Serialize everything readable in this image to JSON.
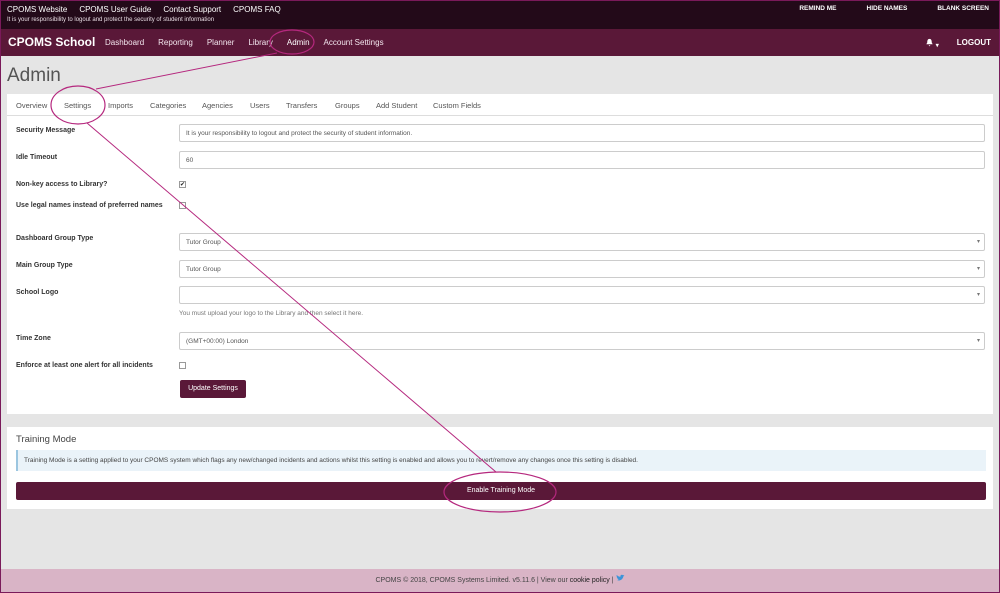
{
  "topbar": {
    "links": [
      "CPOMS Website",
      "CPOMS User Guide",
      "Contact Support",
      "CPOMS FAQ"
    ],
    "note": "It is your responsibility to logout and protect the security of student information",
    "right": [
      "REMIND ME",
      "HIDE NAMES",
      "BLANK SCREEN"
    ]
  },
  "navbar": {
    "brand": "CPOMS School",
    "items": [
      "Dashboard",
      "Reporting",
      "Planner",
      "Library",
      "Admin",
      "Account Settings"
    ],
    "bell": "▲ ▾",
    "logout": "LOGOUT"
  },
  "page": {
    "title": "Admin"
  },
  "tabs": [
    "Overview",
    "Settings",
    "Imports",
    "Categories",
    "Agencies",
    "Users",
    "Transfers",
    "Groups",
    "Add Student",
    "Custom Fields"
  ],
  "settings": {
    "security_message_label": "Security Message",
    "security_message_value": "It is your responsibility to logout and protect the security of student information.",
    "idle_timeout_label": "Idle Timeout",
    "idle_timeout_value": "60",
    "nonkey_label": "Non-key access to Library?",
    "legal_names_label": "Use legal names instead of preferred names",
    "dashboard_group_label": "Dashboard Group Type",
    "dashboard_group_value": "Tutor Group",
    "main_group_label": "Main Group Type",
    "main_group_value": "Tutor Group",
    "school_logo_label": "School Logo",
    "school_logo_value": "",
    "school_logo_help": "You must upload your logo to the Library and then select it here.",
    "time_zone_label": "Time Zone",
    "time_zone_value": "(GMT+00:00) London",
    "enforce_alert_label": "Enforce at least one alert for all incidents",
    "update_button": "Update Settings",
    "check_mark": "✔"
  },
  "training": {
    "title": "Training Mode",
    "info": "Training Mode is a setting applied to your CPOMS system which flags any new/changed incidents and actions whilst this setting is enabled and allows you to revert/remove any changes once this setting is disabled.",
    "button": "Enable Training Mode"
  },
  "footer": {
    "text": "CPOMS © 2018, CPOMS Systems Limited. v5.11.6 | View our ",
    "link": "cookie policy",
    "sep": " | ",
    "twitter": "♥"
  },
  "colors": {
    "brand": "#5a1838",
    "topbar": "#230a19",
    "annotation": "#b5287e"
  }
}
